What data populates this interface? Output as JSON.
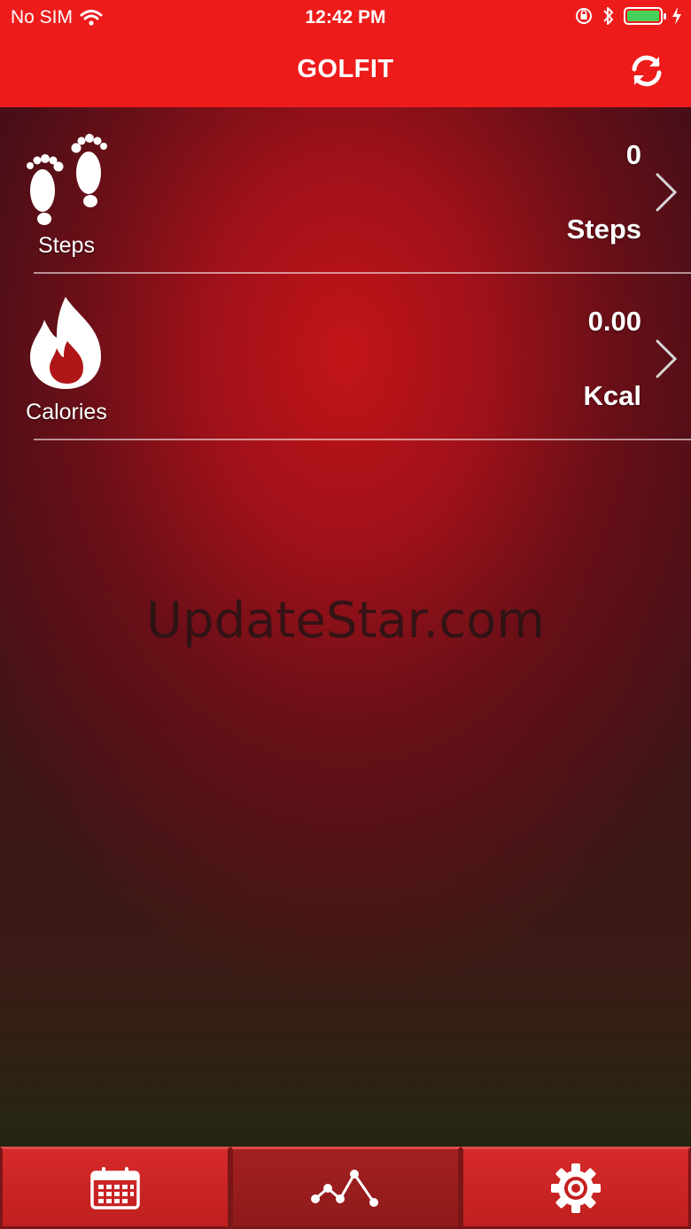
{
  "status_bar": {
    "carrier": "No SIM",
    "time": "12:42 PM"
  },
  "nav": {
    "title": "GOLFIT"
  },
  "metrics": [
    {
      "label": "Steps",
      "value": "0",
      "unit": "Steps",
      "icon": "footprints-icon"
    },
    {
      "label": "Calories",
      "value": "0.00",
      "unit": "Kcal",
      "icon": "flame-icon"
    }
  ],
  "watermark": "UpdateStar.com",
  "tabs": [
    {
      "icon": "calendar-icon",
      "active": false
    },
    {
      "icon": "activity-chart-icon",
      "active": true
    },
    {
      "icon": "gear-icon",
      "active": false
    }
  ],
  "colors": {
    "accent": "#ee1b1b",
    "battery": "#46d25a"
  }
}
